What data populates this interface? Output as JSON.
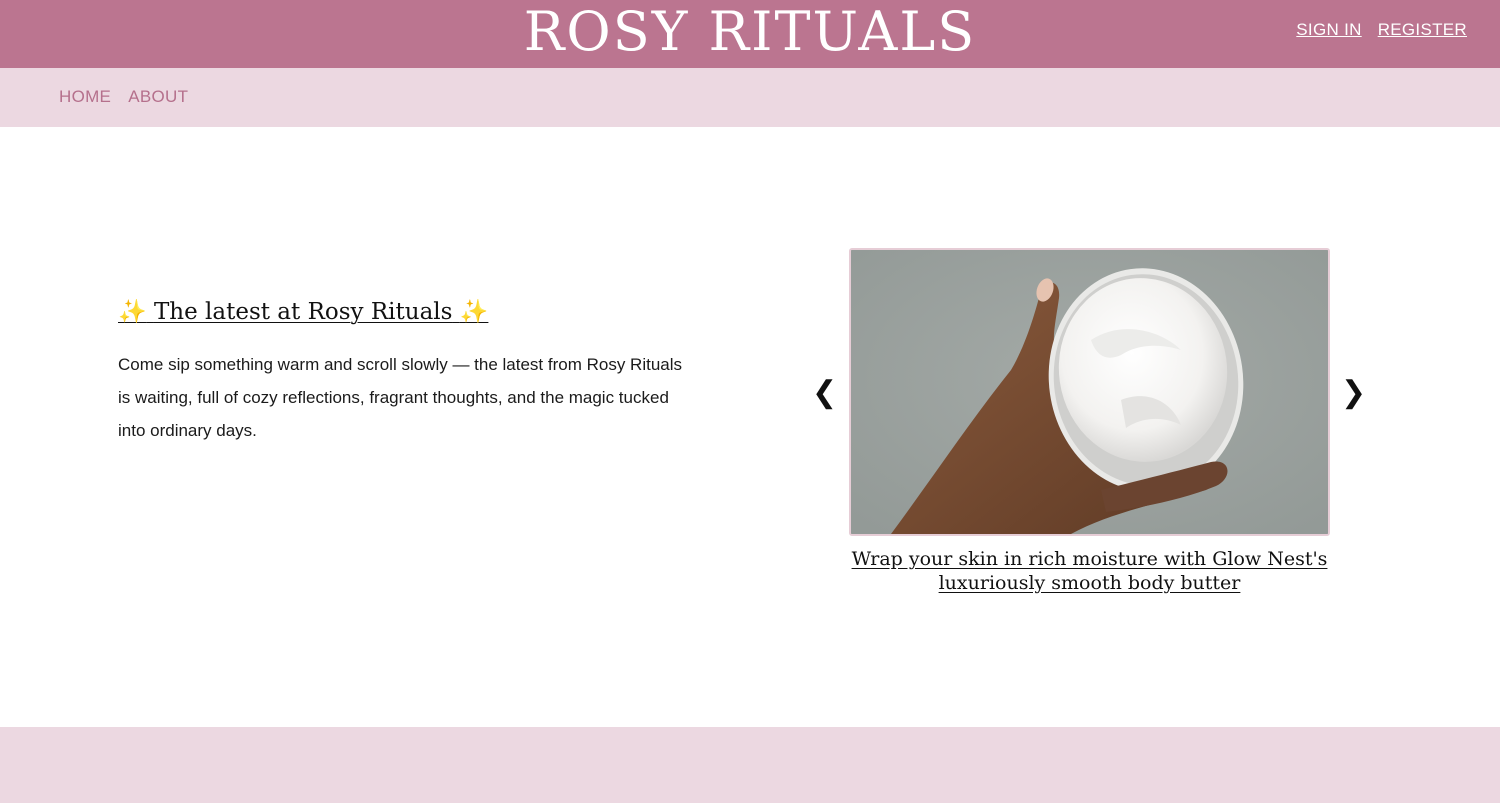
{
  "header": {
    "brand": "ROSY RITUALS",
    "sign_in": "SIGN IN",
    "register": "REGISTER",
    "bg_color": "#bb7590"
  },
  "nav": {
    "items": [
      {
        "label": "HOME"
      },
      {
        "label": "ABOUT"
      }
    ],
    "bg_color": "#ecd8e1"
  },
  "intro": {
    "sparkle_left": "✨",
    "title": "The latest at Rosy Rituals",
    "sparkle_right": "✨",
    "body": "Come sip something warm and scroll slowly — the latest from Rosy Rituals is waiting, full of cozy reflections, fragrant thoughts, and the magic tucked into ordinary days."
  },
  "carousel": {
    "prev_icon": "❮",
    "next_icon": "❯",
    "image": "hand holding jar of white body butter",
    "caption": "Wrap your skin in rich moisture with Glow Nest's luxuriously smooth body butter"
  }
}
